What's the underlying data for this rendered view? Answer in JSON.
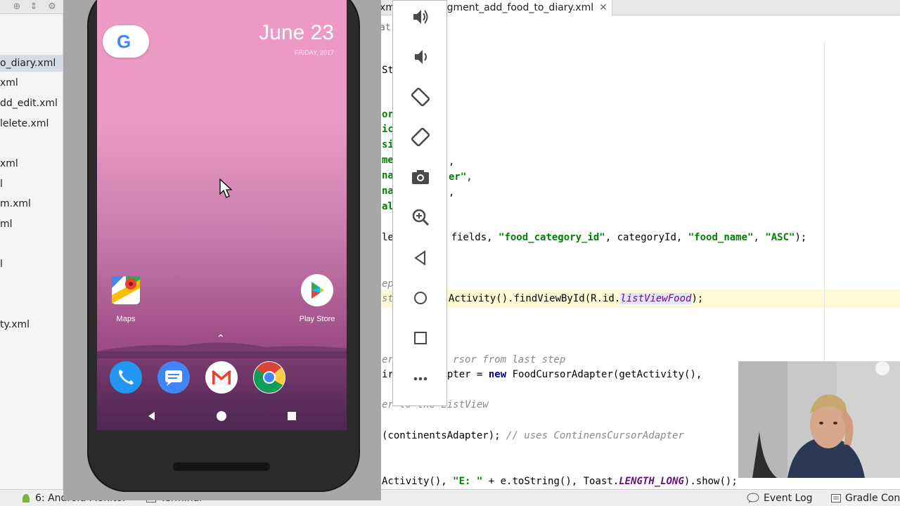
{
  "project_files": [
    {
      "name": "o_diary.xml",
      "selected": true
    },
    {
      "name": "xml",
      "selected": false
    },
    {
      "name": "dd_edit.xml",
      "selected": false
    },
    {
      "name": "lelete.xml",
      "selected": false
    },
    {
      "name": "xml",
      "selected": false
    },
    {
      "name": "l",
      "selected": false
    },
    {
      "name": "m.xml",
      "selected": false
    },
    {
      "name": "ml",
      "selected": false
    },
    {
      "name": "l",
      "selected": false
    },
    {
      "name": "ty.xml",
      "selected": false
    }
  ],
  "editor_tabs": {
    "partial_left": "xm",
    "active": "agment_add_food_to_diary.xml",
    "close_glyph": "✕"
  },
  "breadcrumb": "at",
  "code": {
    "line1_prefix": "St",
    "call_select": "le",
    "select_args_1": "1\", fields, ",
    "select_str_1": "\"food_category_id\"",
    "select_args_2": ", categoryId, ",
    "select_str_2": "\"food_name\"",
    "select_args_3": ", ",
    "select_str_3": "\"ASC\"",
    "select_args_4": ");",
    "comment_partial": "ep",
    "find_prefix": "st",
    "find_call": "Activity().findViewById(R.id.",
    "find_field": "listViewFood",
    "find_suffix": ");",
    "comment_cursor": "er          rsor from last step",
    "adapter_prefix": "ir",
    "adapter_mid": "pter = ",
    "adapter_kw": "new",
    "adapter_call": " FoodCursorAdapter(getActivity(), ",
    "comment_listview": "er to the ListView",
    "set_adapter": "(continentsAdapter); ",
    "set_adapter_comment": "// uses ContinensCursorAdapter",
    "toast_call": "Activity(), ",
    "toast_str": "\"E: \"",
    "toast_mid": " + e.toString(), Toast.",
    "toast_field": "LENGTH_LONG",
    "toast_end": ").show();",
    "partial_green": [
      "or",
      "ic",
      "si",
      "me",
      "na",
      "na",
      "al"
    ],
    "partial_tail_1": ",",
    "partial_tail_2": "er\",",
    "partial_tail_3": ","
  },
  "status_bar": {
    "android_monitor": "6: Android Monitor",
    "terminal": "Terminal",
    "event_log": "Event Log",
    "gradle_console": "Gradle Cons"
  },
  "phone": {
    "date": "June 23",
    "day_of_week": "FRIDAY, 2017",
    "google_letter": "G",
    "apps": [
      {
        "label": "Maps",
        "icon": "maps-icon"
      },
      {
        "label": "Play Store",
        "icon": "play-store-icon"
      }
    ],
    "dock": [
      "phone-icon",
      "messages-icon",
      "gmail-icon",
      "chrome-icon"
    ],
    "dock_up": "⌃"
  },
  "emulator_tools": [
    "volume-up-icon",
    "volume-down-icon",
    "rotate-left-icon",
    "rotate-right-icon",
    "camera-icon",
    "zoom-icon",
    "back-icon",
    "home-icon",
    "overview-icon",
    "more-icon"
  ],
  "colors": {
    "string": "#008000",
    "keyword": "#000080",
    "field": "#660e7a",
    "comment": "#8a8a8a"
  }
}
